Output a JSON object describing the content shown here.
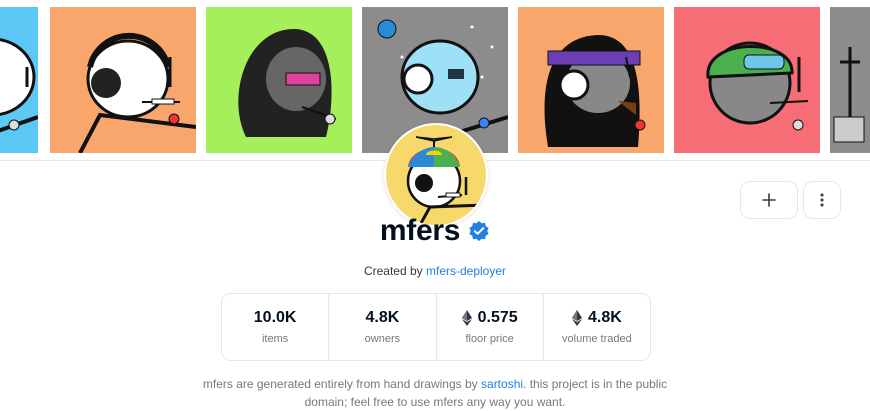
{
  "collection": {
    "title": "mfers",
    "verified_icon": "verified-badge-icon",
    "created_prefix": "Created by",
    "creator": "mfers-deployer"
  },
  "actions": {
    "add_icon": "plus-icon",
    "more_icon": "more-vertical-icon"
  },
  "banner": {
    "tiles": [
      {
        "bg": "#5bc8f5"
      },
      {
        "bg": "#f9a66c"
      },
      {
        "bg": "#a5ef5a"
      },
      {
        "bg": "#8c8c8c"
      },
      {
        "bg": "#f9a66c"
      },
      {
        "bg": "#f66d75"
      },
      {
        "bg": "#8c8c8c"
      }
    ]
  },
  "stats": [
    {
      "value": "10.0K",
      "label": "items",
      "eth": false
    },
    {
      "value": "4.8K",
      "label": "owners",
      "eth": false
    },
    {
      "value": "0.575",
      "label": "floor price",
      "eth": true
    },
    {
      "value": "4.8K",
      "label": "volume traded",
      "eth": true
    }
  ],
  "description": {
    "part1": "mfers are generated entirely from hand drawings by",
    "link": "sartoshi",
    "part2": ". this project is in the public",
    "line2": "domain; feel free to use mfers any way you want."
  }
}
